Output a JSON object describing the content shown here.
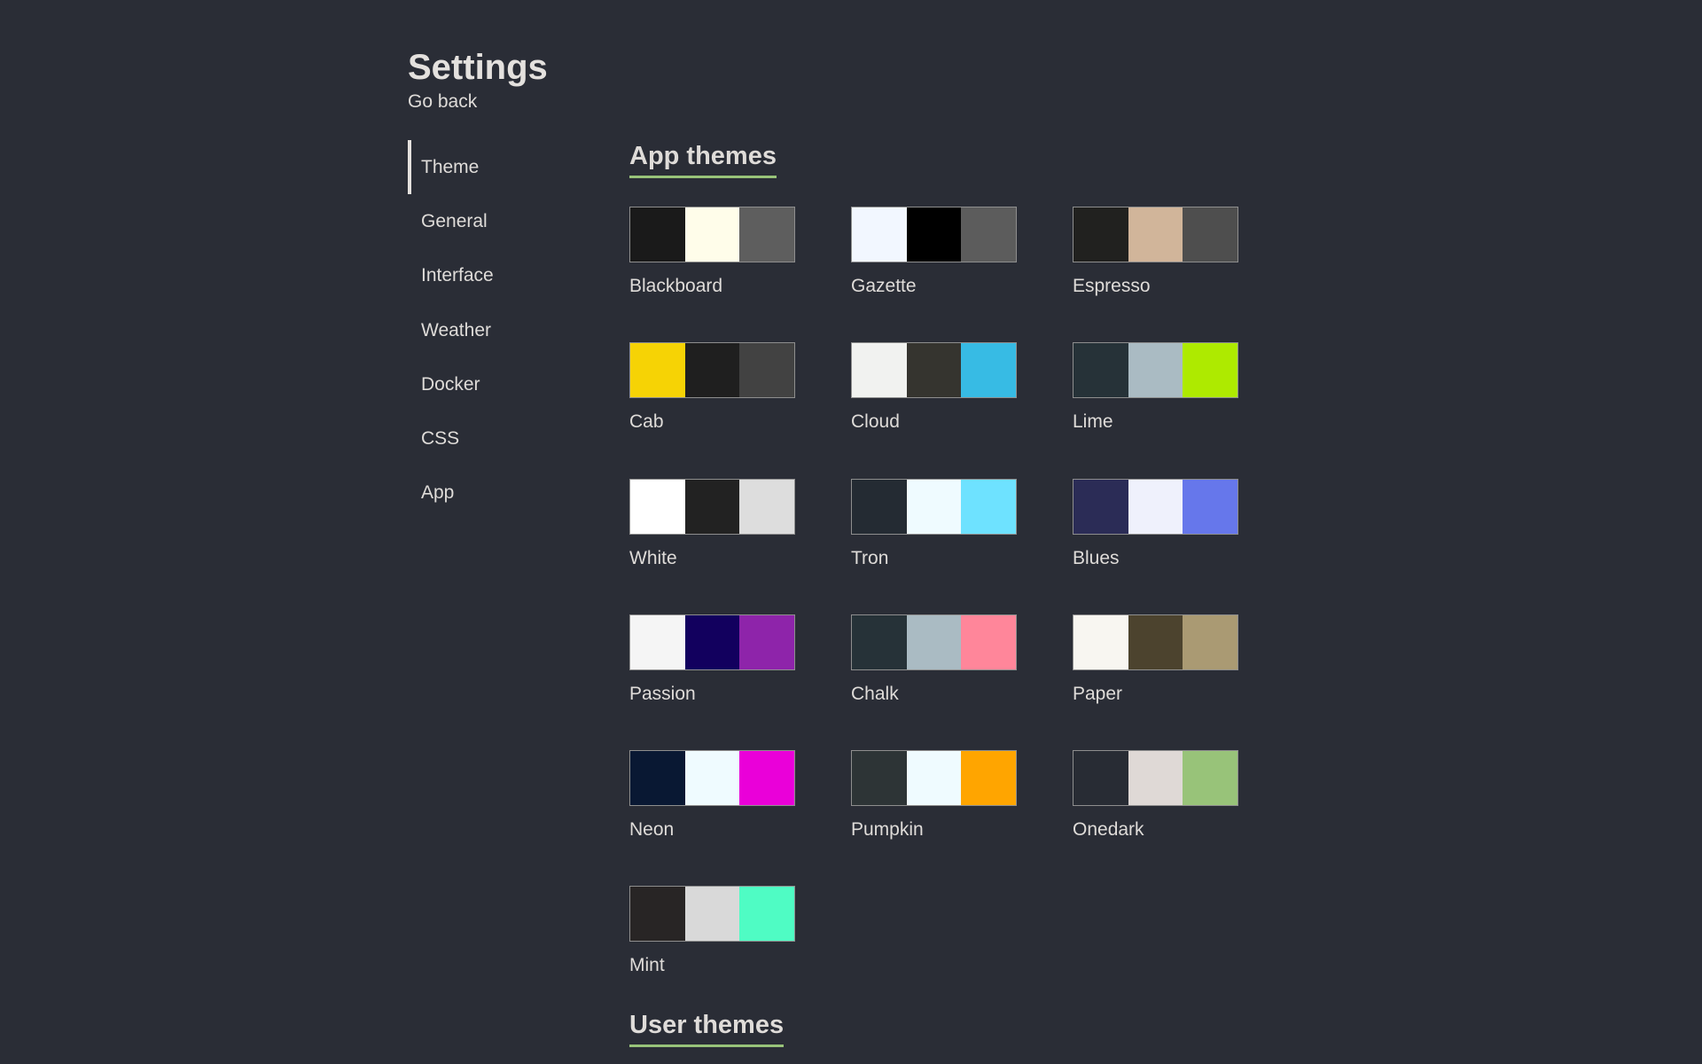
{
  "header": {
    "title": "Settings",
    "go_back": "Go back"
  },
  "sidebar": {
    "items": [
      {
        "label": "Theme",
        "active": true
      },
      {
        "label": "General"
      },
      {
        "label": "Interface"
      },
      {
        "label": "Weather"
      },
      {
        "label": "Docker"
      },
      {
        "label": "CSS"
      },
      {
        "label": "App"
      }
    ]
  },
  "app_themes": {
    "title": "App themes",
    "accent": "#98c379",
    "themes": [
      {
        "name": "Blackboard",
        "colors": [
          "#1a1a1a",
          "#fffdea",
          "#5e5e5e"
        ]
      },
      {
        "name": "Gazette",
        "colors": [
          "#f2f7ff",
          "#000000",
          "#5c5c5c"
        ]
      },
      {
        "name": "Espresso",
        "colors": [
          "#21211f",
          "#d1b59a",
          "#4e4e4e"
        ]
      },
      {
        "name": "Cab",
        "colors": [
          "#f6d305",
          "#1f1f1f",
          "#424242"
        ]
      },
      {
        "name": "Cloud",
        "colors": [
          "#f1f2f0",
          "#35342f",
          "#37bbe4"
        ]
      },
      {
        "name": "Lime",
        "colors": [
          "#263238",
          "#aabbc3",
          "#aeea00"
        ]
      },
      {
        "name": "White",
        "colors": [
          "#ffffff",
          "#222222",
          "#dddddd"
        ]
      },
      {
        "name": "Tron",
        "colors": [
          "#242b33",
          "#effbff",
          "#6ee2ff"
        ]
      },
      {
        "name": "Blues",
        "colors": [
          "#2b2c56",
          "#eff1fc",
          "#6677eb"
        ]
      },
      {
        "name": "Passion",
        "colors": [
          "#f5f5f5",
          "#12005e",
          "#8e24aa"
        ]
      },
      {
        "name": "Chalk",
        "colors": [
          "#263238",
          "#aabbc3",
          "#ff869a"
        ]
      },
      {
        "name": "Paper",
        "colors": [
          "#f8f6f1",
          "#4c432e",
          "#aa9a73"
        ]
      },
      {
        "name": "Neon",
        "colors": [
          "#091833",
          "#effbff",
          "#ea00d9"
        ]
      },
      {
        "name": "Pumpkin",
        "colors": [
          "#2d3436",
          "#effbff",
          "#ffa500"
        ]
      },
      {
        "name": "Onedark",
        "colors": [
          "#282c34",
          "#dfd9d6",
          "#98c379"
        ]
      },
      {
        "name": "Mint",
        "colors": [
          "#282525",
          "#d9d9d9",
          "#4ffcc4"
        ]
      }
    ]
  },
  "user_themes": {
    "title": "User themes"
  }
}
